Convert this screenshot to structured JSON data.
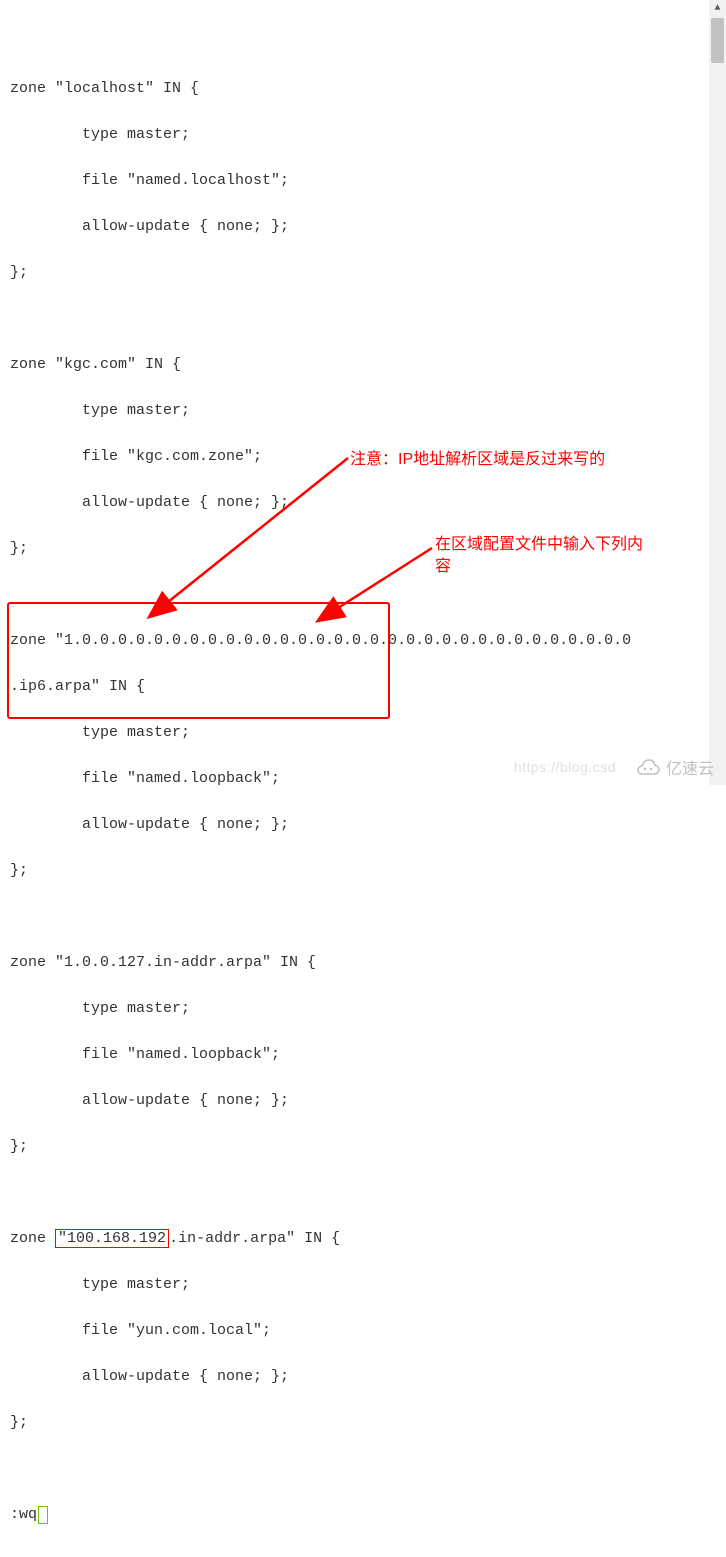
{
  "code": {
    "l1": "",
    "l2": "zone \"localhost\" IN {",
    "l3": "        type master;",
    "l4": "        file \"named.localhost\";",
    "l5": "        allow-update { none; };",
    "l6": "};",
    "l7": "",
    "l8": "zone \"kgc.com\" IN {",
    "l9": "        type master;",
    "l10": "        file \"kgc.com.zone\";",
    "l11": "        allow-update { none; };",
    "l12": "};",
    "l13": "",
    "l14": "zone \"1.0.0.0.0.0.0.0.0.0.0.0.0.0.0.0.0.0.0.0.0.0.0.0.0.0.0.0.0.0.0.0",
    "l15": ".ip6.arpa\" IN {",
    "l16": "        type master;",
    "l17": "        file \"named.loopback\";",
    "l18": "        allow-update { none; };",
    "l19": "};",
    "l20": "",
    "l21": "zone \"1.0.0.127.in-addr.arpa\" IN {",
    "l22": "        type master;",
    "l23": "        file \"named.loopback\";",
    "l24": "        allow-update { none; };",
    "l25": "};",
    "l26": "",
    "l27_prefix": "zone ",
    "l27_quote": "\"",
    "l27_ip": "100.168.192",
    "l27_suffix": ".in-addr.arpa\" IN {",
    "l28": "        type master;",
    "l29": "        file \"yun.com.local\";",
    "l30": "        allow-update { none; };",
    "l31": "};",
    "l32": "",
    "l33": ":wq"
  },
  "annotation1": "注意：IP地址解析区域是反过来写的",
  "annotation2_a": "在区域配置文件中输入下列内",
  "annotation2_b": "容",
  "watermark_text": "https://blog.csd",
  "watermark_logo": "亿速云"
}
